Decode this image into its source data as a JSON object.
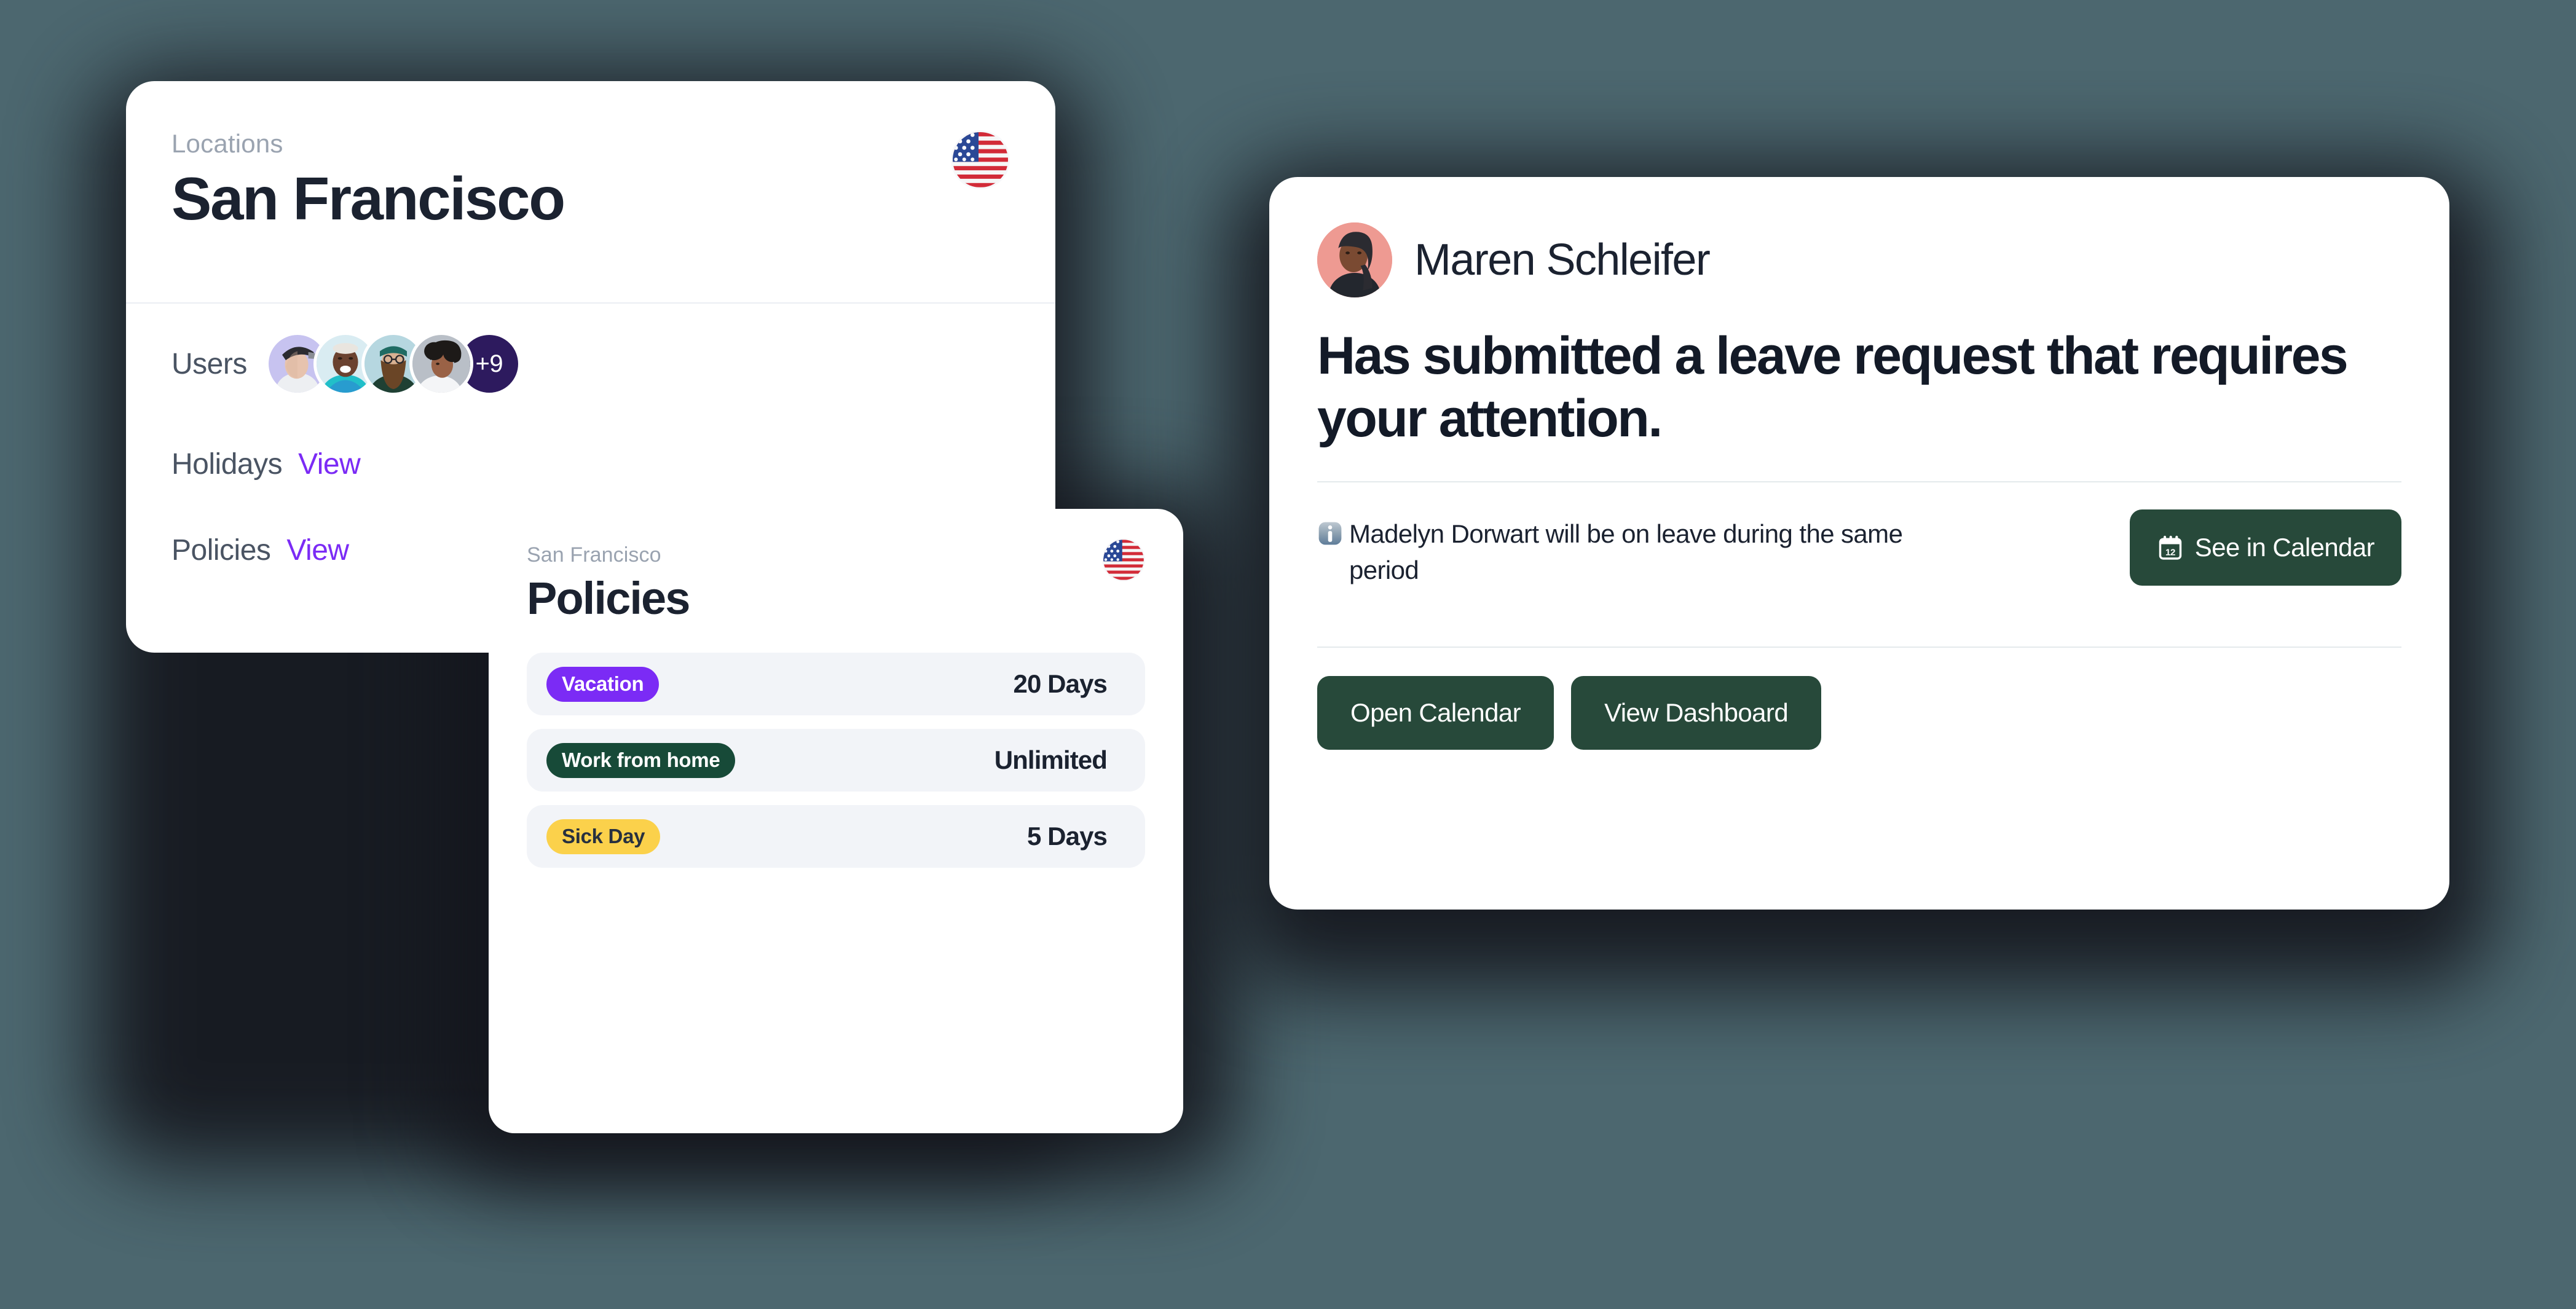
{
  "theme": {
    "background": "#4C676F",
    "card_background": "#FFFFFF",
    "accent_purple": "#7B2BF5",
    "accent_green": "#27493A",
    "badge_green": "#174A38",
    "badge_yellow": "#FBD14B",
    "avatar_more_bg": "#2D1A5E",
    "text_dark": "#1B2230",
    "text_muted": "#9AA3B0"
  },
  "locations_card": {
    "eyebrow": "Locations",
    "title": "San Francisco",
    "flag_icon": "us-flag-icon",
    "rows": {
      "users_label": "Users",
      "users_overflow": "+9",
      "users_avatar_count": 4,
      "holidays_label": "Holidays",
      "holidays_link": "View",
      "policies_label": "Policies",
      "policies_link": "View"
    }
  },
  "policies_card": {
    "eyebrow": "San Francisco",
    "title": "Policies",
    "flag_icon": "us-flag-icon",
    "policies": [
      {
        "name": "Vacation",
        "value": "20 Days",
        "badge_color": "#7B2BF5"
      },
      {
        "name": "Work from home",
        "value": "Unlimited",
        "badge_color": "#174A38"
      },
      {
        "name": "Sick Day",
        "value": "5 Days",
        "badge_color": "#FBD14B"
      }
    ]
  },
  "notification_card": {
    "person_name": "Maren Schleifer",
    "avatar_icon": "user-avatar",
    "headline": "Has submitted a leave request that requires your attention.",
    "note_icon": "information-emoji",
    "note": "Madelyn Dorwart will be on leave during the same period",
    "see_in_calendar_button": {
      "label": "See in Calendar",
      "icon": "calendar-12-icon"
    },
    "actions": [
      {
        "label": "Open Calendar"
      },
      {
        "label": "View Dashboard"
      }
    ]
  }
}
